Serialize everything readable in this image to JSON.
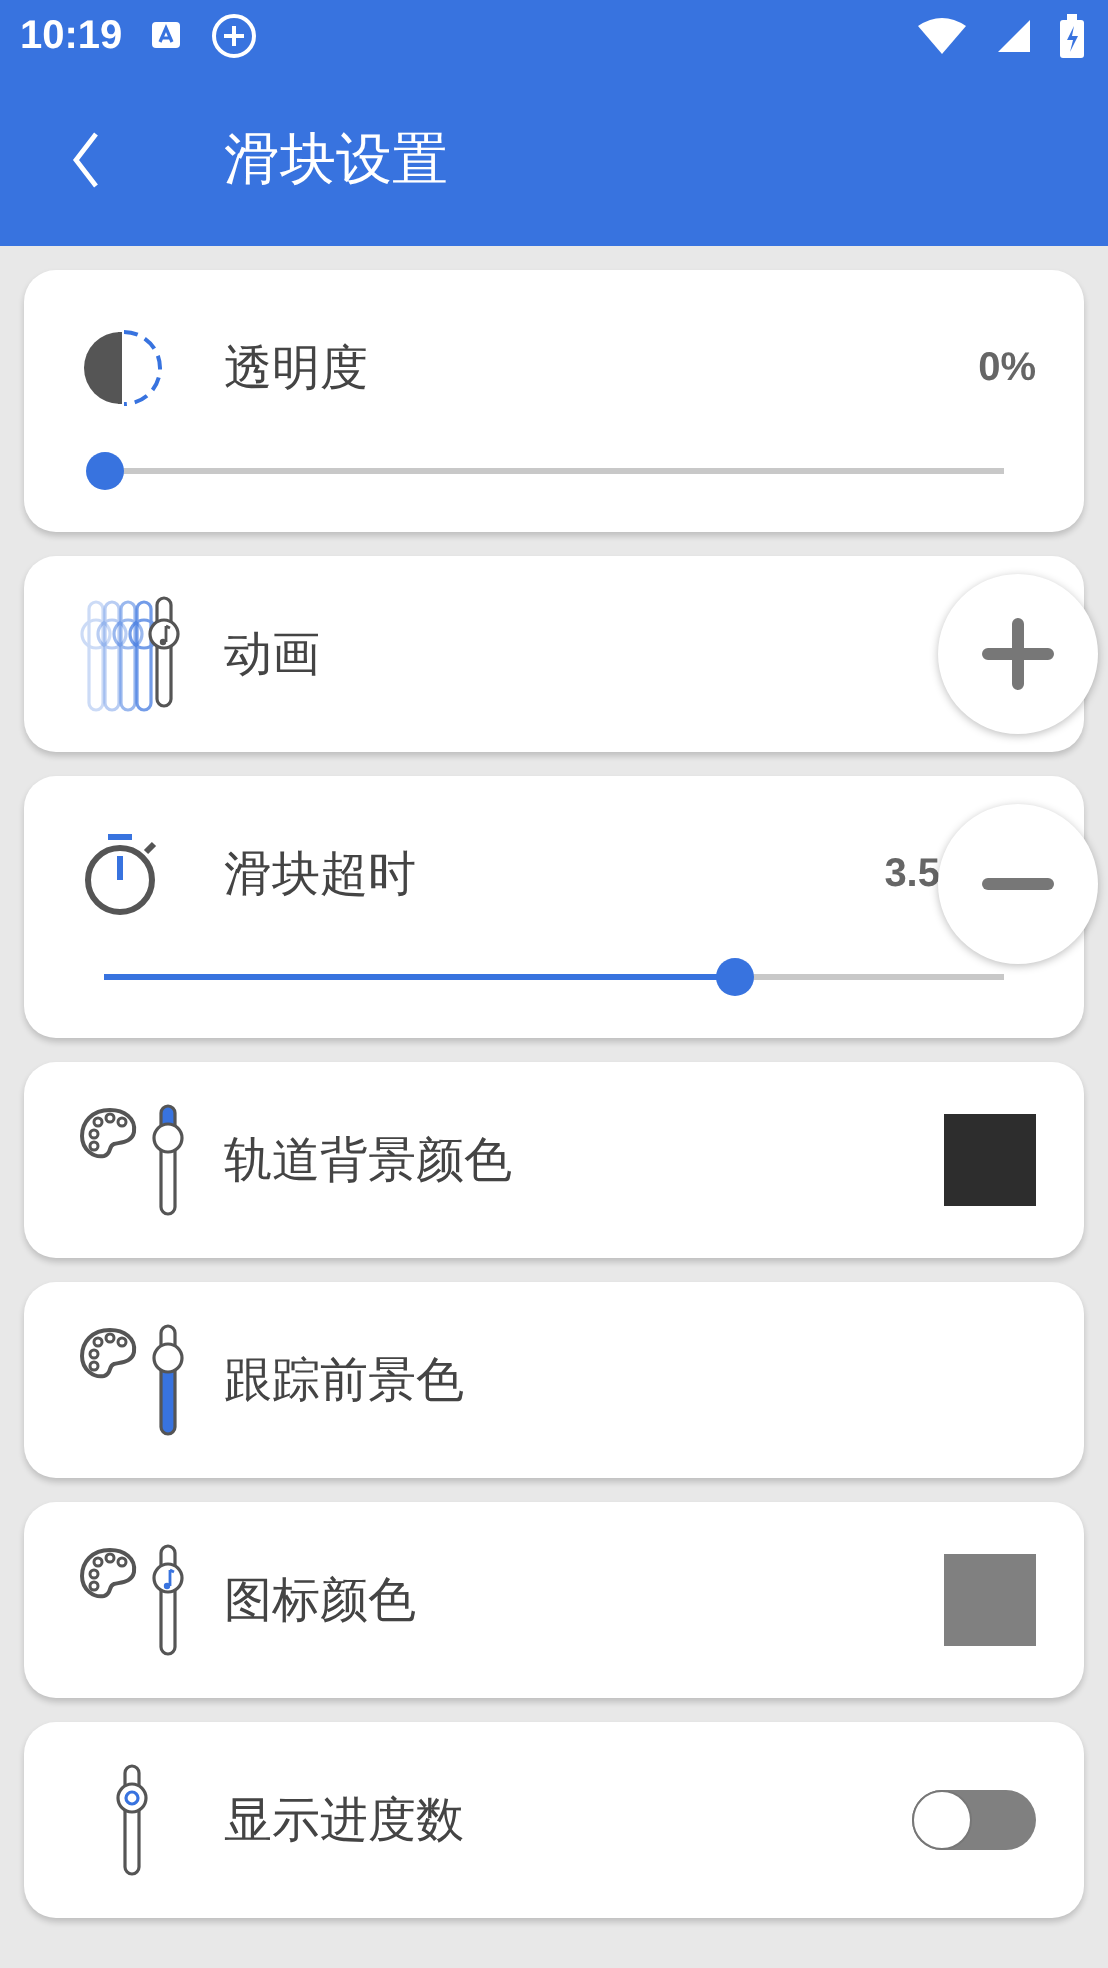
{
  "status_bar": {
    "time": "10:19"
  },
  "app_bar": {
    "title": "滑块设置"
  },
  "settings": [
    {
      "kind": "slider",
      "label": "透明度",
      "value": "0%",
      "level": 0.0
    },
    {
      "kind": "plain",
      "label": "动画"
    },
    {
      "kind": "slider",
      "label": "滑块超时",
      "value": "3.5",
      "level": 0.7
    },
    {
      "kind": "color",
      "label": "轨道背景颜色",
      "color": "#2d2d2d"
    },
    {
      "kind": "plain",
      "label": "跟踪前景色"
    },
    {
      "kind": "color",
      "label": "图标颜色",
      "color": "#808080"
    },
    {
      "kind": "toggle",
      "label": "显示进度数",
      "on": false
    }
  ],
  "floating_buttons": [
    {
      "kind": "plus"
    },
    {
      "kind": "minus"
    }
  ]
}
